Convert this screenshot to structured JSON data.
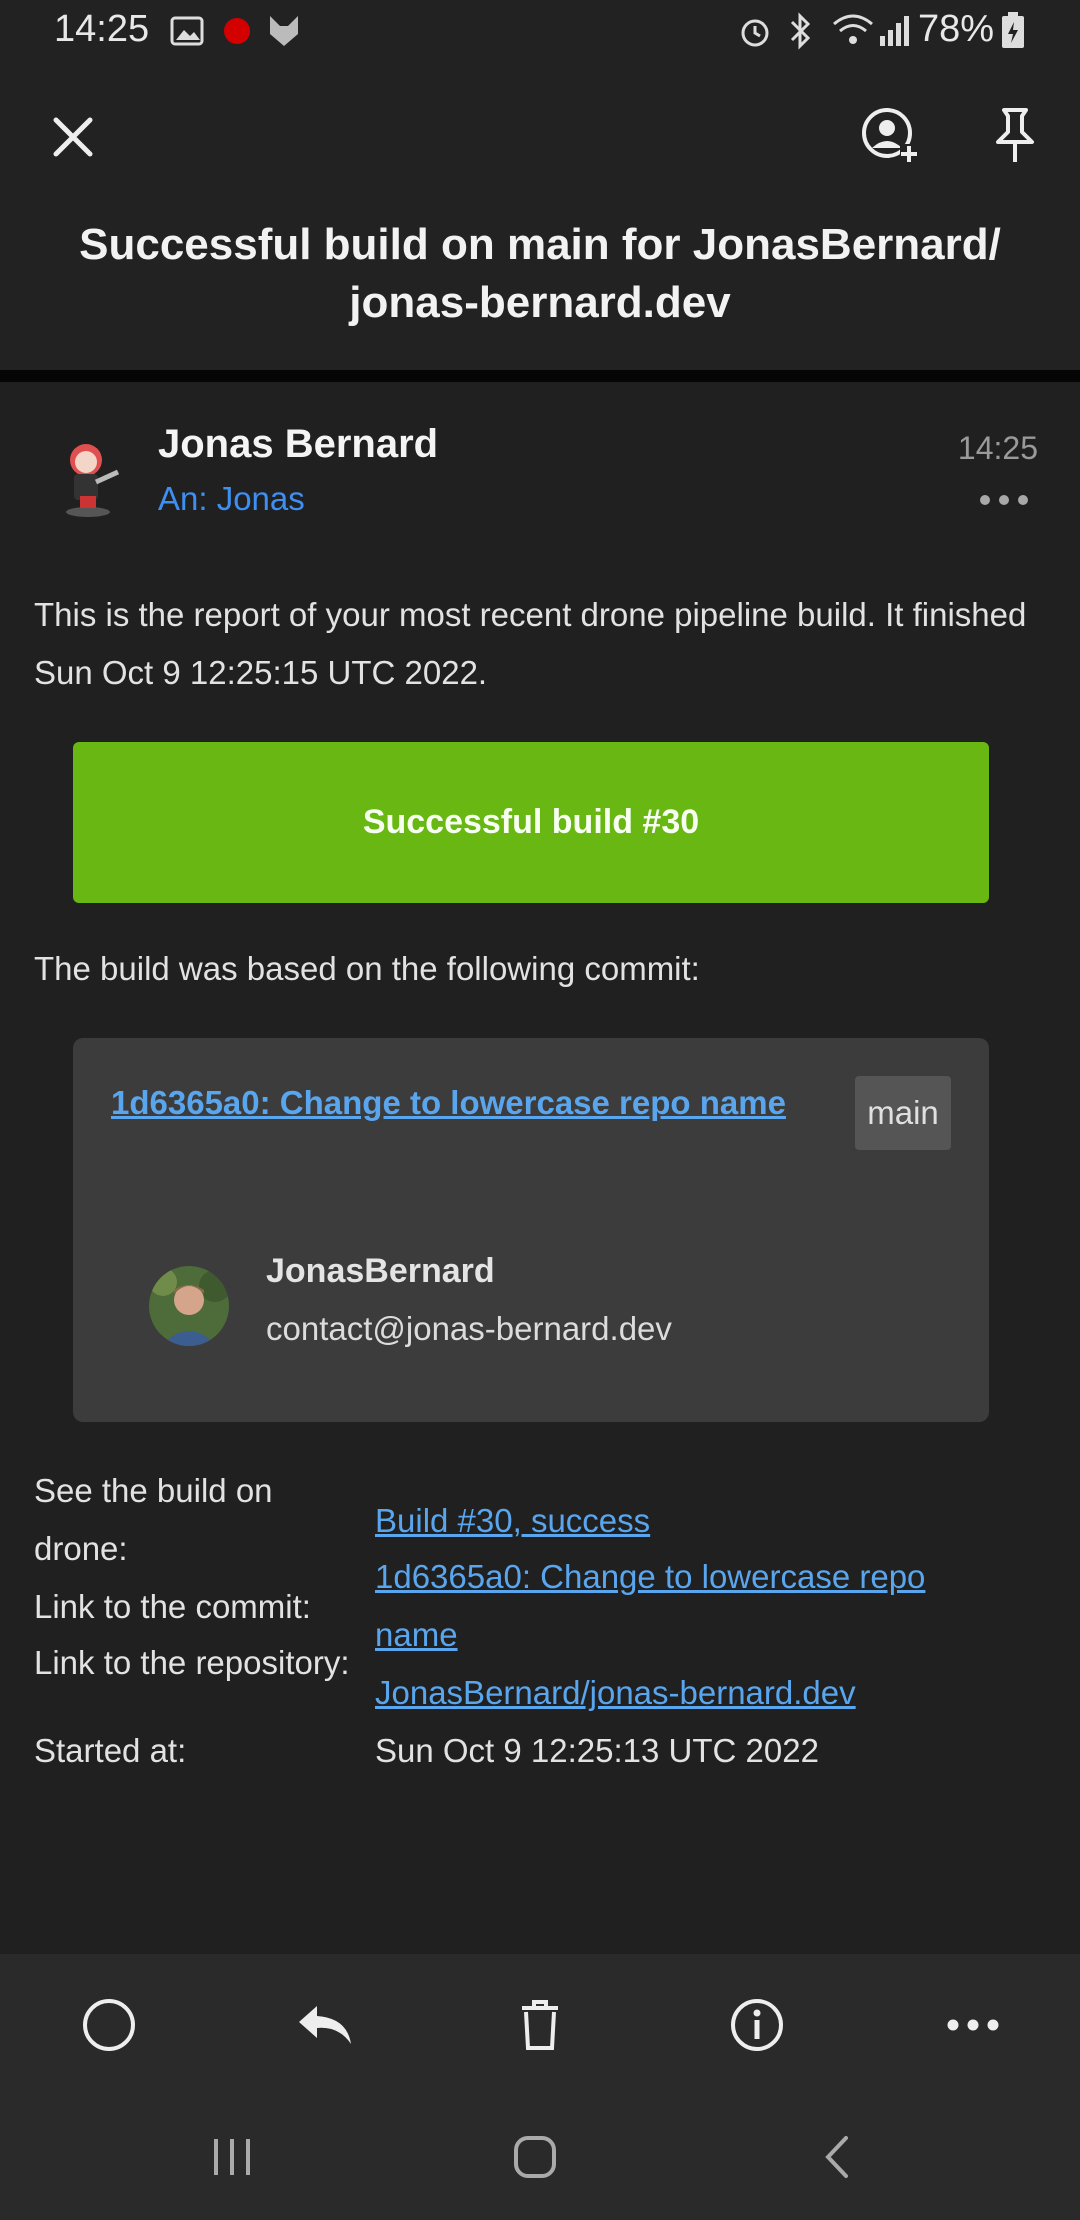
{
  "status_bar": {
    "time": "14:25",
    "battery": "78%"
  },
  "header": {
    "title": "Successful build on main for JonasBernard/ jonas-bernard.dev"
  },
  "email": {
    "sender_name": "Jonas Bernard",
    "recipient": "An: Jonas",
    "time": "14:25",
    "intro": "This is the report of your most recent drone pipeline build. It finished Sun Oct 9 12:25:15 UTC 2022.",
    "build_button": "Successful build #30",
    "commit_intro": "The build was based on the following commit:",
    "commit": {
      "link": "1d6365a0: Change to lowercase repo name",
      "branch": "main",
      "author_name": "JonasBernard",
      "author_email": "contact@jonas-bernard.dev"
    },
    "details": [
      {
        "label": "See the build on drone:",
        "value": "Build #30, success"
      },
      {
        "label": "Link to the commit:",
        "value": "1d6365a0: Change to lowercase repo name"
      },
      {
        "label": "Link to the repository:",
        "value": "JonasBernard/jonas-bernard.dev"
      },
      {
        "label": "Started at:",
        "value": "Sun Oct 9 12:25:13 UTC 2022"
      }
    ]
  },
  "colors": {
    "accent_link": "#5aa6ee",
    "success_green": "#68b712",
    "recipient_blue": "#3e8ff2"
  },
  "icons": {
    "header": [
      "close-icon",
      "add-contact-icon",
      "pin-icon"
    ],
    "toolbar": [
      "circle-icon",
      "reply-icon",
      "delete-icon",
      "info-icon",
      "more-icon"
    ],
    "navbar": [
      "recents-icon",
      "home-icon",
      "back-icon"
    ]
  }
}
